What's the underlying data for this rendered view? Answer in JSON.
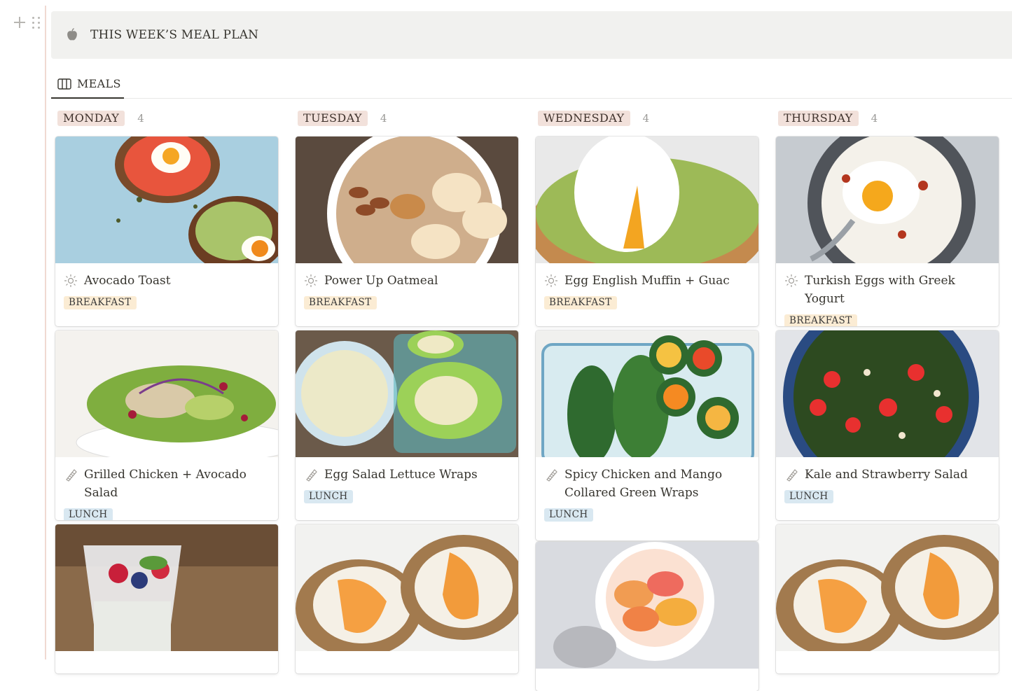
{
  "page": {
    "title": "THIS WEEK’S MEAL PLAN",
    "title_icon": "apple-icon",
    "view_tab": "MEALS",
    "view_icon": "board-icon"
  },
  "colors": {
    "callout_bg": "#f1f1ef",
    "column_tag_bg": "#f2e1db",
    "breakfast_tag_bg": "#fbecd4",
    "lunch_tag_bg": "#d9e8f1"
  },
  "columns": [
    {
      "day": "MONDAY",
      "count": "4",
      "cards": [
        {
          "title": "Avocado Toast",
          "icon": "sun-icon",
          "tag": "BREAKFAST"
        },
        {
          "title": "Grilled Chicken + Avocado Salad",
          "icon": "salad-icon",
          "tag": "LUNCH"
        },
        {
          "title": "",
          "icon": "",
          "tag": ""
        }
      ]
    },
    {
      "day": "TUESDAY",
      "count": "4",
      "cards": [
        {
          "title": "Power Up Oatmeal",
          "icon": "sun-icon",
          "tag": "BREAKFAST"
        },
        {
          "title": "Egg Salad Lettuce Wraps",
          "icon": "salad-icon",
          "tag": "LUNCH"
        },
        {
          "title": "",
          "icon": "",
          "tag": ""
        }
      ]
    },
    {
      "day": "WEDNESDAY",
      "count": "4",
      "cards": [
        {
          "title": "Egg English Muffin + Guac",
          "icon": "sun-icon",
          "tag": "BREAKFAST"
        },
        {
          "title": "Spicy Chicken and Mango Collared Green Wraps",
          "icon": "salad-icon",
          "tag": "LUNCH"
        },
        {
          "title": "",
          "icon": "",
          "tag": ""
        }
      ]
    },
    {
      "day": "THURSDAY",
      "count": "4",
      "cards": [
        {
          "title": "Turkish Eggs with Greek Yogurt",
          "icon": "sun-icon",
          "tag": "BREAKFAST"
        },
        {
          "title": "Kale and Strawberry Salad",
          "icon": "salad-icon",
          "tag": "LUNCH"
        },
        {
          "title": "",
          "icon": "",
          "tag": ""
        }
      ]
    }
  ]
}
